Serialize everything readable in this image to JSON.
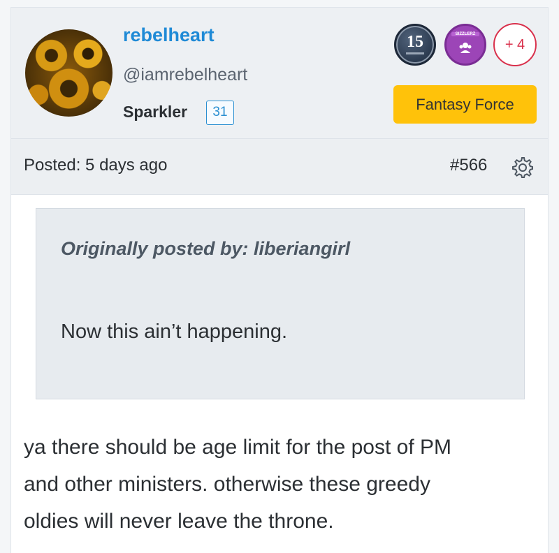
{
  "author": {
    "username": "rebelheart",
    "handle": "@iamrebelheart",
    "rank": "Sparkler",
    "rank_count": "31"
  },
  "badges": {
    "years_badge": "15",
    "sizzle_badge_label": "SIZZLERZ",
    "more_count": "+ 4"
  },
  "flair": "Fantasy Force",
  "post": {
    "posted": "Posted: 5 days ago",
    "number": "#566"
  },
  "quote": {
    "by": "Originally posted by: liberiangirl",
    "text": "Now this ain’t happening."
  },
  "body_lines": [
    "ya there should be age limit for the post of PM",
    "and other ministers. otherwise these greedy",
    "oldies will never leave the throne."
  ],
  "colors": {
    "username": "#1f8ad6",
    "flair_bg": "#ffc20a",
    "plus_badge": "#d9304b",
    "sizzle_badge": "#9c45b7"
  },
  "icons": [
    "gear-icon",
    "avatar-image",
    "years-badge-icon",
    "sizzle-badge-icon"
  ]
}
